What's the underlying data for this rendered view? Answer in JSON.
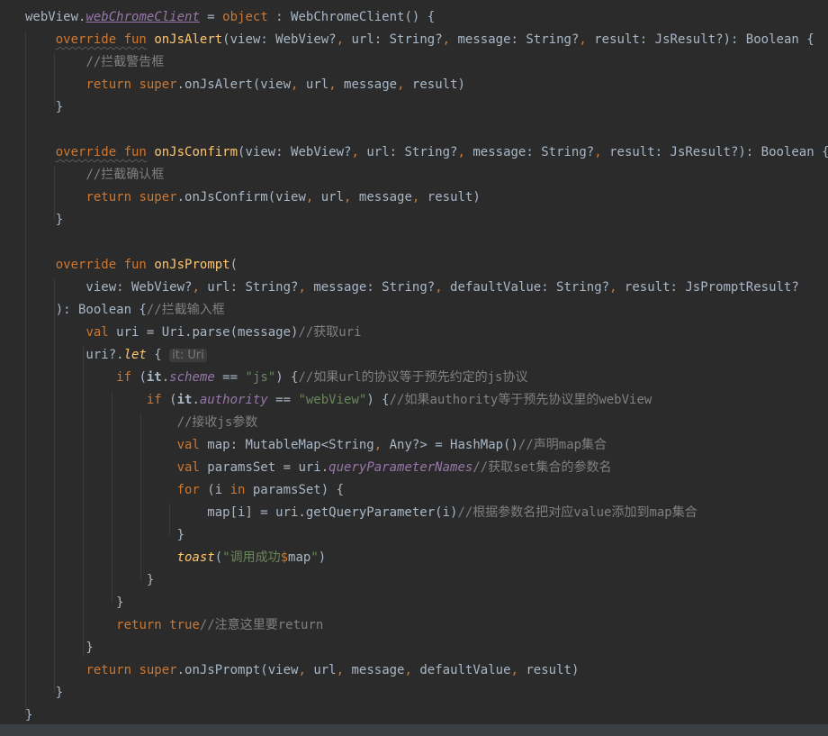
{
  "editor": {
    "colors": {
      "background": "#2b2b2b",
      "keyword": "#cc7832",
      "function": "#ffc66d",
      "string": "#6a8759",
      "comment": "#808080",
      "property": "#9876aa",
      "default": "#a9b7c6"
    },
    "lines": [
      [
        {
          "t": "webView."
        },
        {
          "t": "webChromeClient",
          "c": "prop und"
        },
        {
          "t": " = "
        },
        {
          "t": "object",
          "c": "kw"
        },
        {
          "t": " : WebChromeClient() {"
        }
      ],
      [
        {
          "t": "    "
        },
        {
          "t": "override fun",
          "c": "kw squig"
        },
        {
          "t": " "
        },
        {
          "t": "onJsAlert",
          "c": "fn"
        },
        {
          "t": "(view: WebView?"
        },
        {
          "t": ",",
          "c": "kw"
        },
        {
          "t": " url: String?"
        },
        {
          "t": ",",
          "c": "kw"
        },
        {
          "t": " message: String?"
        },
        {
          "t": ",",
          "c": "kw"
        },
        {
          "t": " result: JsResult?): Boolean {"
        }
      ],
      [
        {
          "t": "        "
        },
        {
          "t": "//拦截警告框",
          "c": "cm"
        }
      ],
      [
        {
          "t": "        "
        },
        {
          "t": "return super",
          "c": "kw"
        },
        {
          "t": ".onJsAlert(view"
        },
        {
          "t": ",",
          "c": "kw"
        },
        {
          "t": " url"
        },
        {
          "t": ",",
          "c": "kw"
        },
        {
          "t": " message"
        },
        {
          "t": ",",
          "c": "kw"
        },
        {
          "t": " result)"
        }
      ],
      [
        {
          "t": "    }"
        }
      ],
      [],
      [
        {
          "t": "    "
        },
        {
          "t": "override fun",
          "c": "kw squig"
        },
        {
          "t": " "
        },
        {
          "t": "onJsConfirm",
          "c": "fn"
        },
        {
          "t": "(view: WebView?"
        },
        {
          "t": ",",
          "c": "kw"
        },
        {
          "t": " url: String?"
        },
        {
          "t": ",",
          "c": "kw"
        },
        {
          "t": " message: String?"
        },
        {
          "t": ",",
          "c": "kw"
        },
        {
          "t": " result: JsResult?): Boolean {"
        }
      ],
      [
        {
          "t": "        "
        },
        {
          "t": "//拦截确认框",
          "c": "cm"
        }
      ],
      [
        {
          "t": "        "
        },
        {
          "t": "return super",
          "c": "kw"
        },
        {
          "t": ".onJsConfirm(view"
        },
        {
          "t": ",",
          "c": "kw"
        },
        {
          "t": " url"
        },
        {
          "t": ",",
          "c": "kw"
        },
        {
          "t": " message"
        },
        {
          "t": ",",
          "c": "kw"
        },
        {
          "t": " result)"
        }
      ],
      [
        {
          "t": "    }"
        }
      ],
      [],
      [
        {
          "t": "    "
        },
        {
          "t": "override fun",
          "c": "kw"
        },
        {
          "t": " "
        },
        {
          "t": "onJsPrompt",
          "c": "fn"
        },
        {
          "t": "("
        }
      ],
      [
        {
          "t": "        view: WebView?"
        },
        {
          "t": ",",
          "c": "kw"
        },
        {
          "t": " url: String?"
        },
        {
          "t": ",",
          "c": "kw"
        },
        {
          "t": " message: String?"
        },
        {
          "t": ",",
          "c": "kw"
        },
        {
          "t": " defaultValue: String?"
        },
        {
          "t": ",",
          "c": "kw"
        },
        {
          "t": " result: JsPromptResult?"
        }
      ],
      [
        {
          "t": "    ): Boolean {"
        },
        {
          "t": "//拦截输入框",
          "c": "cm"
        }
      ],
      [
        {
          "t": "        "
        },
        {
          "t": "val",
          "c": "kw"
        },
        {
          "t": " uri = Uri.parse(message)"
        },
        {
          "t": "//获取uri",
          "c": "cm"
        }
      ],
      [
        {
          "t": "        uri?."
        },
        {
          "t": "let",
          "c": "fn ital"
        },
        {
          "t": " { "
        },
        {
          "t": "it: Uri",
          "c": "hint"
        }
      ],
      [
        {
          "t": "            "
        },
        {
          "t": "if",
          "c": "kw"
        },
        {
          "t": " ("
        },
        {
          "t": "it",
          "c": "bold"
        },
        {
          "t": "."
        },
        {
          "t": "scheme",
          "c": "prop"
        },
        {
          "t": " == "
        },
        {
          "t": "\"js\"",
          "c": "str"
        },
        {
          "t": ") {"
        },
        {
          "t": "//如果url的协议等于预先约定的js协议",
          "c": "cm"
        }
      ],
      [
        {
          "t": "                "
        },
        {
          "t": "if",
          "c": "kw"
        },
        {
          "t": " ("
        },
        {
          "t": "it",
          "c": "bold"
        },
        {
          "t": "."
        },
        {
          "t": "authority",
          "c": "prop"
        },
        {
          "t": " == "
        },
        {
          "t": "\"webView\"",
          "c": "str"
        },
        {
          "t": ") {"
        },
        {
          "t": "//如果authority等于预先协议里的webView",
          "c": "cm"
        }
      ],
      [
        {
          "t": "                    "
        },
        {
          "t": "//接收js参数",
          "c": "cm"
        }
      ],
      [
        {
          "t": "                    "
        },
        {
          "t": "val",
          "c": "kw"
        },
        {
          "t": " map: MutableMap<String"
        },
        {
          "t": ",",
          "c": "kw"
        },
        {
          "t": " Any?> = HashMap()"
        },
        {
          "t": "//声明map集合",
          "c": "cm"
        }
      ],
      [
        {
          "t": "                    "
        },
        {
          "t": "val",
          "c": "kw"
        },
        {
          "t": " paramsSet = uri."
        },
        {
          "t": "queryParameterNames",
          "c": "prop"
        },
        {
          "t": "//获取set集合的参数名",
          "c": "cm"
        }
      ],
      [
        {
          "t": "                    "
        },
        {
          "t": "for",
          "c": "kw"
        },
        {
          "t": " (i "
        },
        {
          "t": "in",
          "c": "kw"
        },
        {
          "t": " paramsSet) {"
        }
      ],
      [
        {
          "t": "                        map[i] = uri.getQueryParameter(i)"
        },
        {
          "t": "//根据参数名把对应value添加到map集合",
          "c": "cm"
        }
      ],
      [
        {
          "t": "                    }"
        }
      ],
      [
        {
          "t": "                    "
        },
        {
          "t": "toast",
          "c": "fn ital"
        },
        {
          "t": "("
        },
        {
          "t": "\"调用成功",
          "c": "str"
        },
        {
          "t": "$",
          "c": "kw"
        },
        {
          "t": "map"
        },
        {
          "t": "\"",
          "c": "str"
        },
        {
          "t": ")"
        }
      ],
      [
        {
          "t": "                }"
        }
      ],
      [
        {
          "t": "            }"
        }
      ],
      [
        {
          "t": "            "
        },
        {
          "t": "return true",
          "c": "kw"
        },
        {
          "t": "//注意这里要return",
          "c": "cm"
        }
      ],
      [
        {
          "t": "        }"
        }
      ],
      [
        {
          "t": "        "
        },
        {
          "t": "return super",
          "c": "kw"
        },
        {
          "t": ".onJsPrompt(view"
        },
        {
          "t": ",",
          "c": "kw"
        },
        {
          "t": " url"
        },
        {
          "t": ",",
          "c": "kw"
        },
        {
          "t": " message"
        },
        {
          "t": ",",
          "c": "kw"
        },
        {
          "t": " defaultValue"
        },
        {
          "t": ",",
          "c": "kw"
        },
        {
          "t": " result)"
        }
      ],
      [
        {
          "t": "    }"
        }
      ],
      [
        {
          "t": "}"
        }
      ]
    ]
  }
}
